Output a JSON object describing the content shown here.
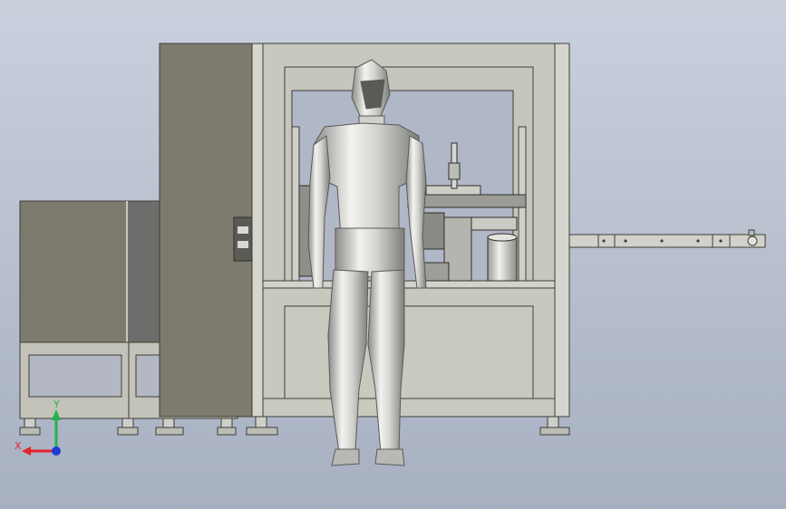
{
  "viewport": {
    "background_top": "#c7cedb",
    "background_bottom": "#a9b2c2"
  },
  "colors": {
    "cabinet": "#7c7b6e",
    "cabinet_panel": "#6f6f6c",
    "frame": "#c9c9bf",
    "frame_edge": "#4a4a44",
    "feet": "#bdbdb8",
    "mannequin": "#e7e7e3",
    "axis_x": "#e3242b",
    "axis_y": "#22b34b",
    "axis_z": "#1f3bd1"
  },
  "triad": {
    "x_label": "X",
    "y_label": "Y"
  }
}
